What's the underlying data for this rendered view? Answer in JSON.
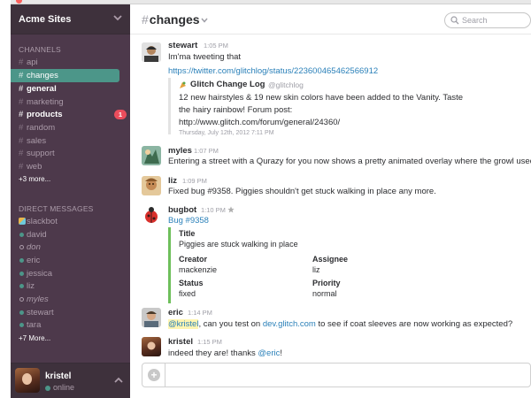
{
  "team": {
    "name": "Acme Sites"
  },
  "sidebar": {
    "channels_title": "CHANNELS",
    "channels": [
      {
        "name": "api",
        "state": "normal"
      },
      {
        "name": "changes",
        "state": "active"
      },
      {
        "name": "general",
        "state": "unread"
      },
      {
        "name": "marketing",
        "state": "normal"
      },
      {
        "name": "products",
        "state": "unread",
        "badge": "1"
      },
      {
        "name": "random",
        "state": "normal"
      },
      {
        "name": "sales",
        "state": "normal"
      },
      {
        "name": "support",
        "state": "normal"
      },
      {
        "name": "web",
        "state": "normal"
      }
    ],
    "channels_more": "+3 more...",
    "dm_title": "DIRECT MESSAGES",
    "dms": [
      {
        "name": "slackbot",
        "status": "bot"
      },
      {
        "name": "david",
        "status": "online"
      },
      {
        "name": "don",
        "status": "away"
      },
      {
        "name": "eric",
        "status": "online"
      },
      {
        "name": "jessica",
        "status": "online"
      },
      {
        "name": "liz",
        "status": "online"
      },
      {
        "name": "myles",
        "status": "away"
      },
      {
        "name": "stewart",
        "status": "online"
      },
      {
        "name": "tara",
        "status": "online"
      }
    ],
    "dms_more": "+7 More..."
  },
  "user": {
    "name": "kristel",
    "status": "online"
  },
  "header": {
    "hash": "#",
    "channel": "changes",
    "search_placeholder": "Search"
  },
  "messages": {
    "m1": {
      "sender": "stewart",
      "time": "1:05 PM",
      "text": "Im'ma tweeting that",
      "link": "https://twitter.com/glitchlog/status/223600465462566912",
      "quote": {
        "source": "Glitch Change Log",
        "handle": "@glitchlog",
        "line1": "12 new hairstyles & 19 new skin colors have been added to the Vanity. Taste",
        "line2": "the hairy rainbow! Forum post:",
        "link": "http://www.glitch.com/forum/general/24360/",
        "date": "Thursday, July 12th, 2012 7:11 PM"
      }
    },
    "m2": {
      "sender": "myles",
      "time": "1:07 PM",
      "text": "Entering a street with a Qurazy for you now shows a pretty animated overlay where the growl used to g"
    },
    "m3": {
      "sender": "liz",
      "time": "1:09 PM",
      "text": "Fixed bug #9358. Piggies shouldn't get stuck walking in place any more."
    },
    "m4": {
      "sender": "bugbot",
      "time": "1:10 PM",
      "link": "Bug #9358",
      "attachment": {
        "title_label": "Title",
        "title_value": "Piggies are stuck walking in place",
        "creator_label": "Creator",
        "creator_value": "mackenzie",
        "assignee_label": "Assignee",
        "assignee_value": "liz",
        "status_label": "Status",
        "status_value": "fixed",
        "priority_label": "Priority",
        "priority_value": "normal"
      }
    },
    "m5": {
      "sender": "eric",
      "time": "1:14 PM",
      "mention": "@kristel",
      "text_a": ", can you test on ",
      "link": "dev.glitch.com",
      "text_b": " to see if coat sleeves are now working as expected?"
    },
    "m6": {
      "sender": "kristel",
      "time": "1:15 PM",
      "text": "indeed they are! thanks ",
      "mention": "@eric",
      "text_end": "!"
    }
  },
  "colors": {
    "sidebar_bg": "#4d394b",
    "header_bg": "#3e313c",
    "active_channel": "#4c9689",
    "badge": "#eb4d5c",
    "link": "#2a80b9",
    "attachment_bar": "#6ebf5b"
  }
}
